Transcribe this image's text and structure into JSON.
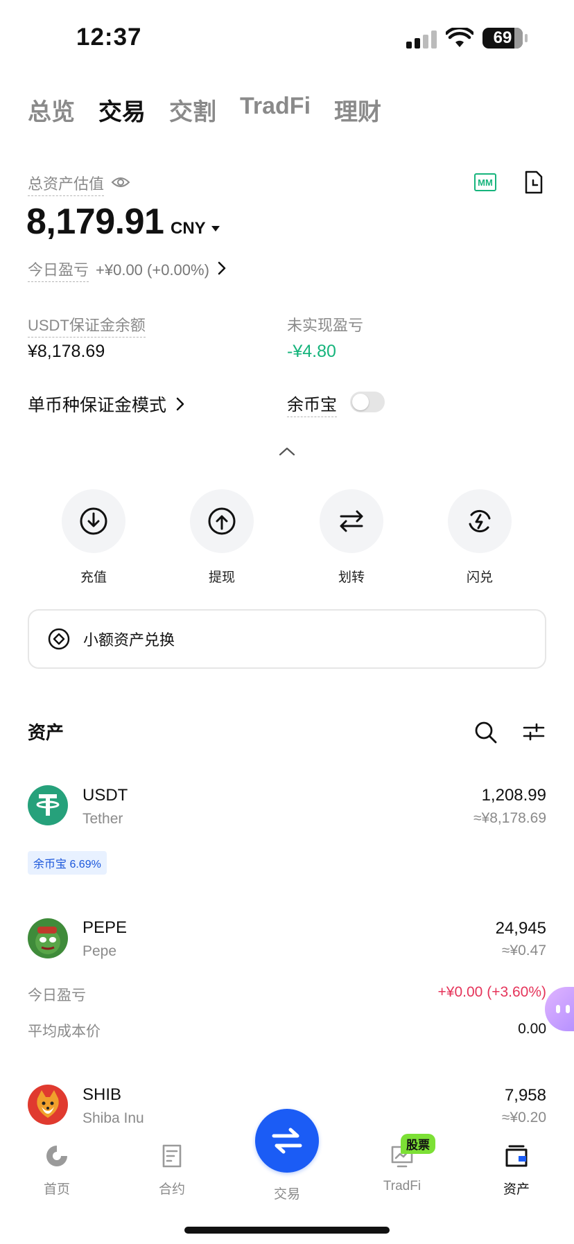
{
  "status_bar": {
    "time": "12:37",
    "battery": "69"
  },
  "tabs": [
    {
      "label": "总览",
      "active": false
    },
    {
      "label": "交易",
      "active": true
    },
    {
      "label": "交割",
      "active": false
    },
    {
      "label": "TradFi",
      "active": false
    },
    {
      "label": "理财",
      "active": false
    }
  ],
  "overview": {
    "total_label": "总资产估值",
    "total_value": "8,179.91",
    "currency": "CNY",
    "today_pnl_label": "今日盈亏",
    "today_pnl_value": "+¥0.00 (+0.00%)",
    "mm_icon_text": "MM",
    "usdt_margin_label": "USDT保证金余额",
    "usdt_margin_value": "¥8,178.69",
    "unrealized_label": "未实现盈亏",
    "unrealized_value": "-¥4.80",
    "mode_label": "单币种保证金模式",
    "yubibao_label": "余币宝",
    "yubibao_toggle_on": false
  },
  "actions": [
    {
      "label": "充值",
      "icon": "deposit-icon"
    },
    {
      "label": "提现",
      "icon": "withdraw-icon"
    },
    {
      "label": "划转",
      "icon": "transfer-icon"
    },
    {
      "label": "闪兑",
      "icon": "flash-convert-icon"
    }
  ],
  "small_convert_label": "小额资产兑换",
  "assets": {
    "title": "资产",
    "items": [
      {
        "symbol": "USDT",
        "name": "Tether",
        "amount": "1,208.99",
        "fiat": "≈¥8,178.69",
        "badge": "余币宝 6.69%"
      },
      {
        "symbol": "PEPE",
        "name": "Pepe",
        "amount": "24,945",
        "fiat": "≈¥0.47",
        "today_pnl_label": "今日盈亏",
        "today_pnl_value": "+¥0.00 (+3.60%)",
        "avg_cost_label": "平均成本价",
        "avg_cost_value": "0.00"
      },
      {
        "symbol": "SHIB",
        "name": "Shiba Inu",
        "amount": "7,958",
        "fiat": "≈¥0.20"
      }
    ]
  },
  "bottom_nav": {
    "items": [
      {
        "label": "首页",
        "active": false
      },
      {
        "label": "合约",
        "active": false
      },
      {
        "label": "交易",
        "active": false
      },
      {
        "label": "TradFi",
        "active": false,
        "badge": "股票"
      },
      {
        "label": "资产",
        "active": true
      }
    ]
  },
  "colors": {
    "accent_blue": "#1b5cf5",
    "profit_green": "#16b47c",
    "loss_red": "#e5345a",
    "badge_green": "#7ce035"
  }
}
